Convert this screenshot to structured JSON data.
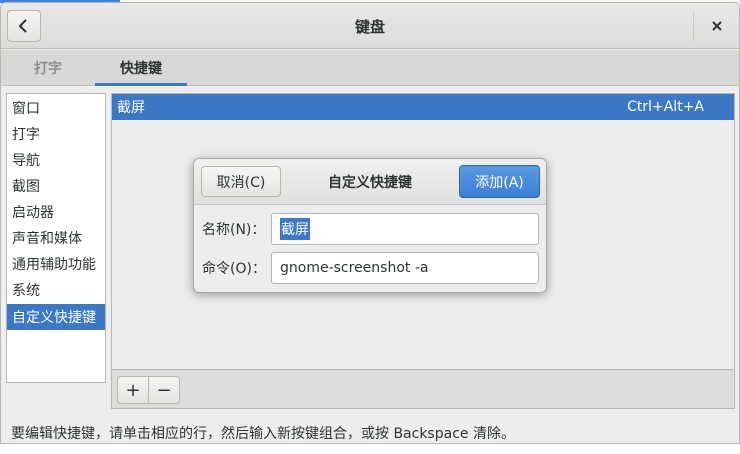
{
  "window": {
    "title": "键盘",
    "back_icon": "chevron-left-icon",
    "close_icon": "close-icon",
    "close_label": "×"
  },
  "tabs": [
    {
      "label": "打字",
      "active": false
    },
    {
      "label": "快捷键",
      "active": true
    }
  ],
  "sidebar": {
    "items": [
      {
        "label": "窗口"
      },
      {
        "label": "打字"
      },
      {
        "label": "导航"
      },
      {
        "label": "截图"
      },
      {
        "label": "启动器"
      },
      {
        "label": "声音和媒体"
      },
      {
        "label": "通用辅助功能"
      },
      {
        "label": "系统"
      },
      {
        "label": "自定义快捷键",
        "selected": true
      }
    ]
  },
  "shortcuts": [
    {
      "name": "截屏",
      "accel": "Ctrl+Alt+A"
    }
  ],
  "toolbar": {
    "add_label": "+",
    "remove_label": "−"
  },
  "hint": "要编辑快捷键，请单击相应的行，然后输入新按键组合，或按 Backspace 清除。",
  "dialog": {
    "title": "自定义快捷键",
    "cancel_label": "取消(C)",
    "add_label": "添加(A)",
    "name_label": "名称(N)：",
    "name_value": "截屏",
    "command_label": "命令(O)：",
    "command_value": "gnome-screenshot -a"
  },
  "colors": {
    "accent": "#3b78c6",
    "suggested_button": "#4a8ddc"
  }
}
